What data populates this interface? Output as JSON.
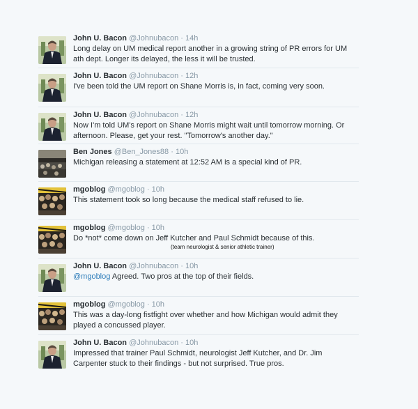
{
  "tweets": [
    {
      "name": "John U. Bacon",
      "handle": "@Johnubacon",
      "time": "14h",
      "text_lines": [
        "Long delay on UM medical report another in a growing string of PR errors for UM",
        "ath dept. Longer its delayed, the less it will be trusted."
      ]
    },
    {
      "name": "John U. Bacon",
      "handle": "@Johnubacon",
      "time": "12h",
      "text_lines": [
        "I've been told the UM report on Shane Morris is, in fact, coming very soon."
      ]
    },
    {
      "name": "John U. Bacon",
      "handle": "@Johnubacon",
      "time": "12h",
      "text_lines": [
        "Now I'm told UM's report on Shane Morris might wait until tomorrow morning. Or",
        "afternoon.  Please, get your rest. \"Tomorrow's another day.\""
      ]
    },
    {
      "name": "Ben Jones",
      "handle": "@Ben_Jones88",
      "time": "10h",
      "text_lines": [
        "Michigan releasing a statement at 12:52 AM is a special kind of PR."
      ]
    },
    {
      "name": "mgoblog",
      "handle": "@mgoblog",
      "time": "10h",
      "text_lines": [
        "This statement took so long because the medical staff refused to lie."
      ]
    },
    {
      "name": "mgoblog",
      "handle": "@mgoblog",
      "time": "10h",
      "text_lines": [
        "Do *not* come down on Jeff Kutcher and Paul Schmidt because of this."
      ],
      "note": "(team neurologist & senior athletic trainer)"
    },
    {
      "name": "John U. Bacon",
      "handle": "@Johnubacon",
      "time": "10h",
      "mention": "@mgoblog",
      "text_lines": [
        " Agreed.  Two pros at the top of their fields."
      ]
    },
    {
      "name": "mgoblog",
      "handle": "@mgoblog",
      "time": "10h",
      "text_lines": [
        "This was a day-long fistfight over whether and how Michigan would admit they",
        "played a concussed player."
      ]
    },
    {
      "name": "John U. Bacon",
      "handle": "@Johnubacon",
      "time": "10h",
      "text_lines": [
        "Impressed that trainer Paul Schmidt, neurologist Jeff Kutcher, and Dr. Jim",
        "Carpenter stuck to their findings - but not surprised. True pros."
      ]
    }
  ],
  "separator": "·"
}
